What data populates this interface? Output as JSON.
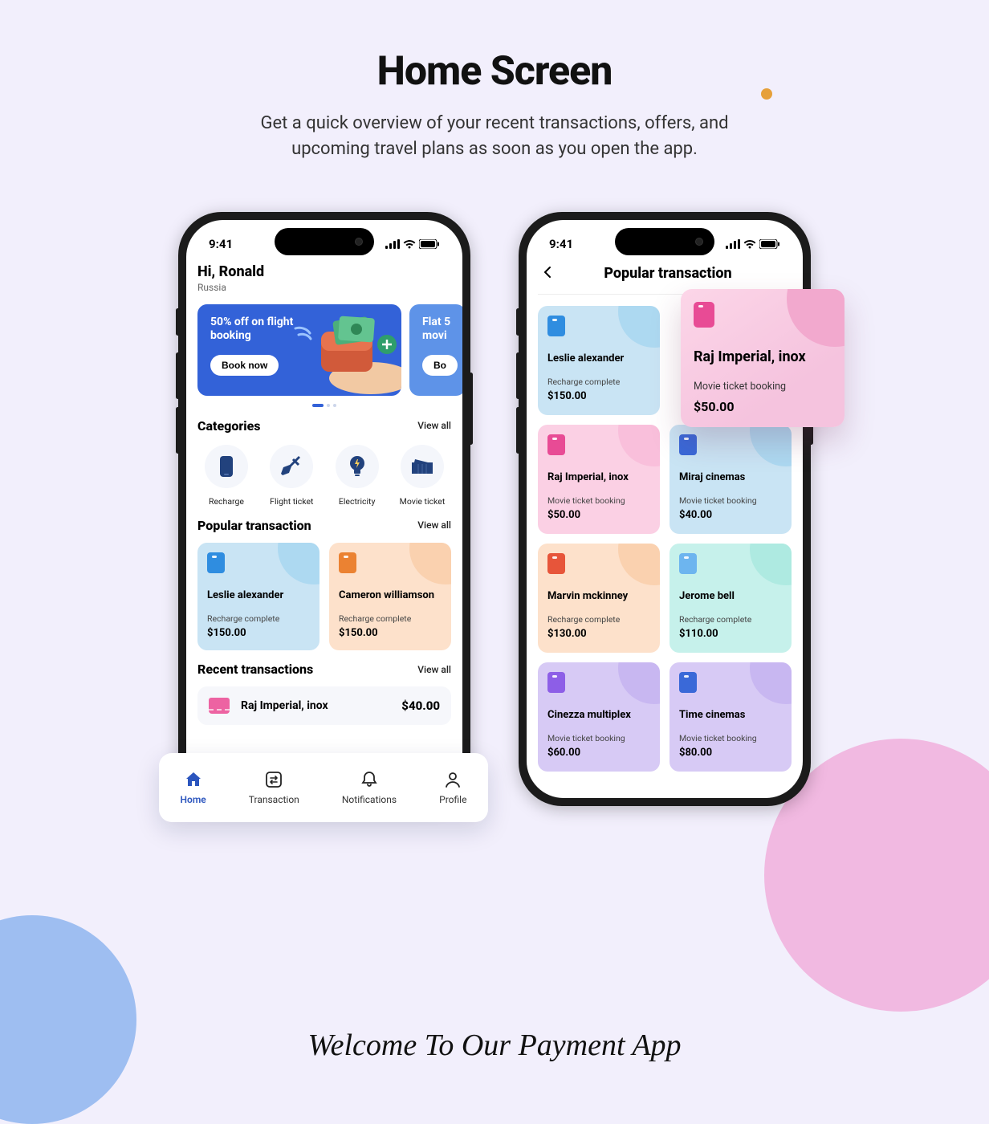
{
  "page": {
    "title": "Home Screen",
    "subtitle": "Get a quick overview of your recent transactions, offers, and upcoming travel plans as soon as you open the app.",
    "footer": "Welcome To Our Payment App"
  },
  "status_time": "9:41",
  "phone1": {
    "greeting": "Hi, Ronald",
    "location": "Russia",
    "promo1_line": "50% off on flight booking",
    "promo1_btn": "Book now",
    "promo2_line": "Flat 5 movi",
    "promo2_btn": "Bo",
    "categories_title": "Categories",
    "view_all": "View all",
    "cats": [
      {
        "label": "Recharge"
      },
      {
        "label": "Flight ticket"
      },
      {
        "label": "Electricity"
      },
      {
        "label": "Movie ticket"
      }
    ],
    "popular_title": "Popular transaction",
    "popular": [
      {
        "name": "Leslie alexander",
        "sub": "Recharge complete",
        "amount": "$150.00"
      },
      {
        "name": "Cameron williamson",
        "sub": "Recharge complete",
        "amount": "$150.00"
      }
    ],
    "recent_title": "Recent transactions",
    "recent": {
      "title": "Raj Imperial, inox",
      "amount": "$40.00"
    },
    "tabs": [
      {
        "label": "Home"
      },
      {
        "label": "Transaction"
      },
      {
        "label": "Notifications"
      },
      {
        "label": "Profile"
      }
    ]
  },
  "phone2": {
    "title": "Popular transaction",
    "highlight": {
      "name": "Raj Imperial, inox",
      "sub": "Movie ticket booking",
      "amount": "$50.00"
    },
    "cards": [
      {
        "name": "Leslie alexander",
        "sub": "Recharge complete",
        "amount": "$150.00",
        "bg": "blue",
        "icon": "blue"
      },
      {
        "name": "Raj Imperial, inox",
        "sub": "Movie ticket booking",
        "amount": "$50.00",
        "bg": "pink",
        "icon": "pink"
      },
      {
        "name": "Miraj cinemas",
        "sub": "Movie ticket booking",
        "amount": "$40.00",
        "bg": "blue",
        "icon": "dblue"
      },
      {
        "name": "Marvin mckinney",
        "sub": "Recharge complete",
        "amount": "$130.00",
        "bg": "orange",
        "icon": "red"
      },
      {
        "name": "Jerome bell",
        "sub": "Recharge complete",
        "amount": "$110.00",
        "bg": "teal",
        "icon": "lblue"
      },
      {
        "name": "Cinezza multiplex",
        "sub": "Movie ticket booking",
        "amount": "$60.00",
        "bg": "purple",
        "icon": "purple"
      },
      {
        "name": "Time cinemas",
        "sub": "Movie ticket booking",
        "amount": "$80.00",
        "bg": "purple",
        "icon": "dblue"
      }
    ]
  }
}
